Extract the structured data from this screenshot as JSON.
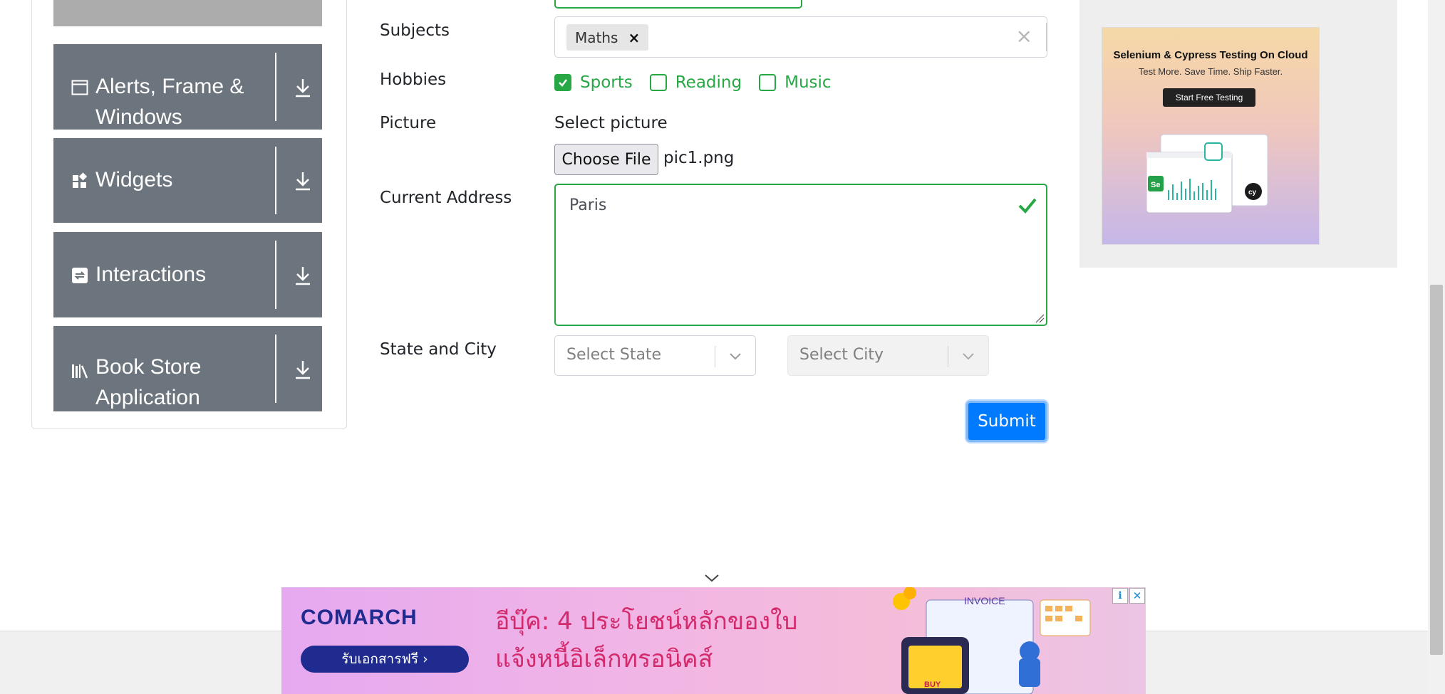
{
  "sidebar": {
    "groups": [
      {
        "label_line1": "Alerts, Frame &",
        "label_line2": "Windows",
        "icon": "window-icon"
      },
      {
        "label_line1": "Widgets",
        "label_line2": "",
        "icon": "widgets-icon"
      },
      {
        "label_line1": "Interactions",
        "label_line2": "",
        "icon": "interactions-icon"
      },
      {
        "label_line1": "Book Store",
        "label_line2": "Application",
        "icon": "books-icon"
      }
    ]
  },
  "form": {
    "subjects": {
      "label": "Subjects",
      "chips": [
        "Maths"
      ],
      "chip_remove": "×",
      "clear": "×"
    },
    "hobbies": {
      "label": "Hobbies",
      "options": [
        {
          "label": "Sports",
          "checked": true
        },
        {
          "label": "Reading",
          "checked": false
        },
        {
          "label": "Music",
          "checked": false
        }
      ]
    },
    "picture": {
      "label": "Picture",
      "prompt": "Select picture",
      "button": "Choose File",
      "filename": "pic1.png"
    },
    "address": {
      "label": "Current Address",
      "value": "Paris"
    },
    "state_city": {
      "label": "State and City",
      "state_placeholder": "Select State",
      "city_placeholder": "Select City"
    },
    "submit": "Submit",
    "accent_valid": "#28a745",
    "accent_primary": "#007bff"
  },
  "side_ad": {
    "title": "Selenium & Cypress Testing On Cloud",
    "subtitle": "Test More. Save Time. Ship Faster.",
    "cta": "Start Free Testing"
  },
  "banner_ad": {
    "brand": "COMARCH",
    "button": "รับเอกสารฟรี ›",
    "line1": "อีบุ๊ค: 4 ประโยชน์หลักของใบ",
    "line2": "แจ้งหนี้อิเล็กทรอนิคส์",
    "art_label": "INVOICE",
    "art_buy": "BUY",
    "info_icon": "info-icon",
    "close_icon": "close-icon"
  }
}
